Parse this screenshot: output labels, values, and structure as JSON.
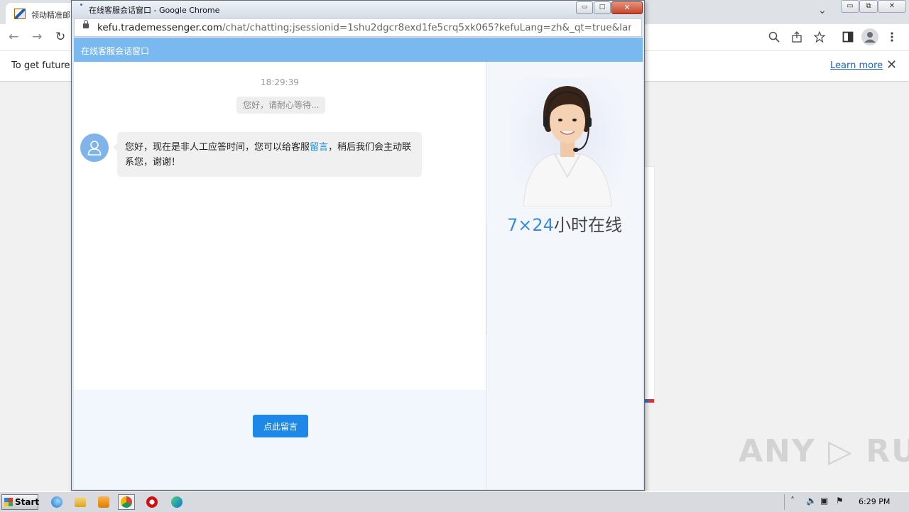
{
  "background_browser": {
    "tab_title": "领动精准邮",
    "infobar_text": "To get future G",
    "learn_more": "Learn more",
    "close_glyph": "✕",
    "nav": {
      "back": "←",
      "forward": "→",
      "reload": "↻"
    },
    "window_buttons": {
      "minimize": "▭",
      "restore": "⧉",
      "close": "✕"
    },
    "dropdown_glyph": "⌄"
  },
  "popup": {
    "window_title": "在线客服会话窗口 - Google Chrome",
    "buttons": {
      "minimize": "▭",
      "maximize": "□",
      "close": "✕"
    },
    "url_host": "kefu.trademessenger.com",
    "url_rest": "/chat/chatting;jsessionid=1shu2dgcr8exd1fe5crq5xk065?kefuLang=zh&_qt=true&language=...",
    "header_title": "在线客服会话窗口",
    "chat": {
      "time": "18:29:39",
      "system_message": "您好，请耐心等待...",
      "agent_message_before": "您好，现在是非人工应答时间，您可以给客服",
      "agent_message_link": "留言",
      "agent_message_after": "，稍后我们会主动联系您，谢谢！"
    },
    "side_panel": {
      "hours_number": "7×24",
      "hours_text": "小时在线"
    },
    "leave_message_button": "点此留言"
  },
  "watermark": "ANY ▷ RUN",
  "taskbar": {
    "start_label": "Start",
    "clock": "6:29 PM"
  },
  "colors": {
    "header_blue": "#79b9f0",
    "button_blue": "#1e88e8",
    "link_blue": "#1d8ad8",
    "hours_blue": "#3c8ad8"
  }
}
